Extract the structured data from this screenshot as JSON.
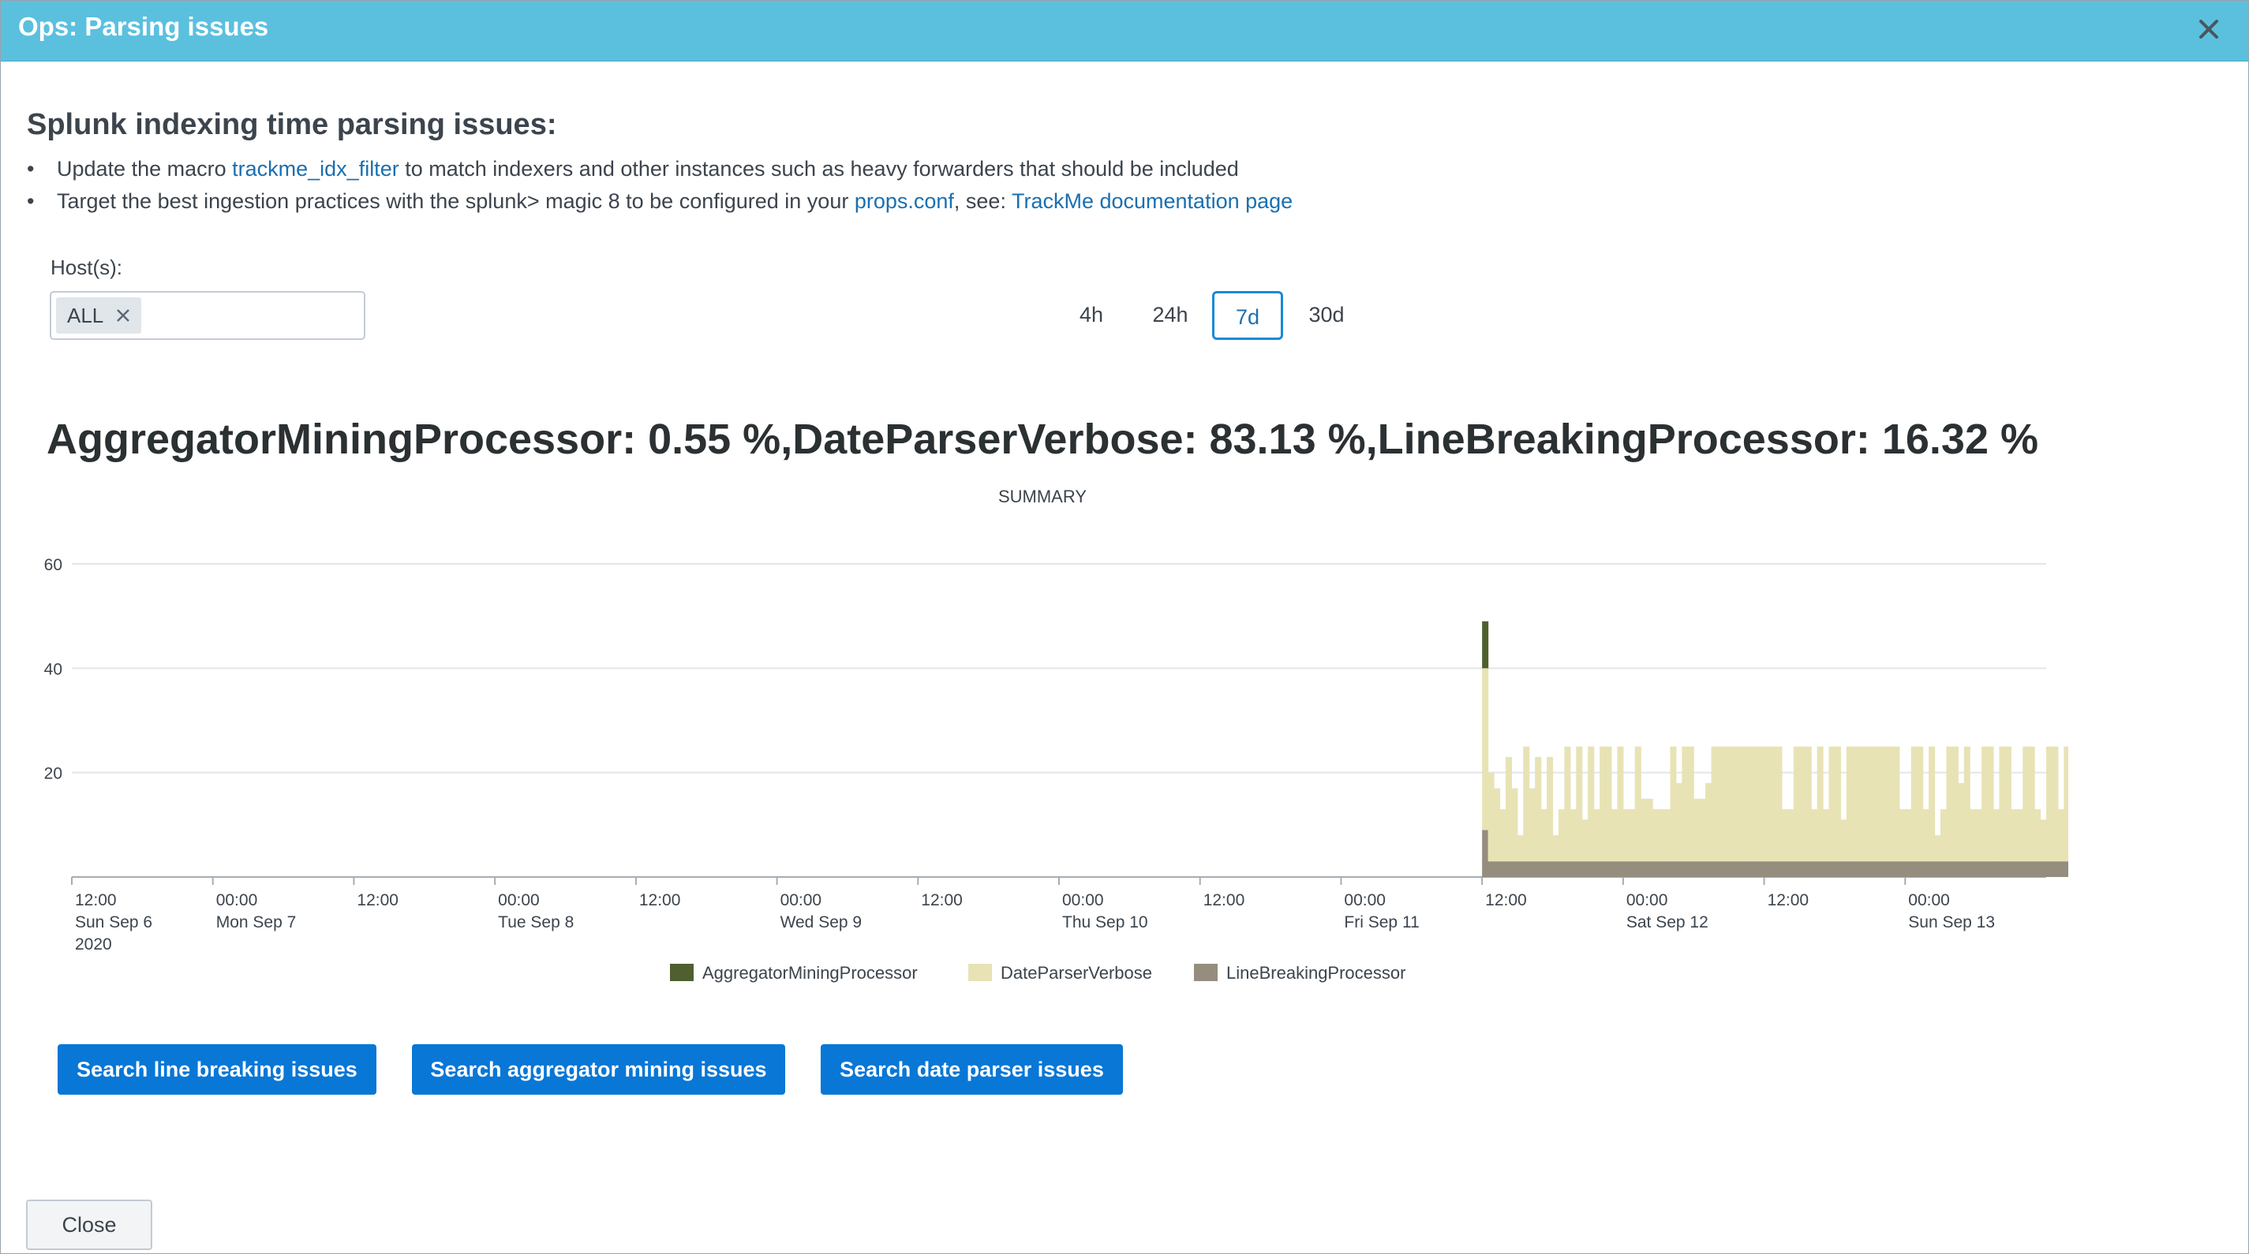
{
  "modal": {
    "title": "Ops: Parsing issues",
    "heading": "Splunk indexing time parsing issues:",
    "bullet1": {
      "prefix": "Update the macro ",
      "link": "trackme_idx_filter",
      "suffix": " to match indexers and other instances such as heavy forwarders that should be included"
    },
    "bullet2": {
      "prefix": "Target the best ingestion practices with the splunk> magic 8 to be configured in your ",
      "link1": "props.conf",
      "middle": ", see: ",
      "link2": "TrackMe documentation page"
    },
    "close_label": "Close"
  },
  "filters": {
    "host_label": "Host(s):",
    "host_values": [
      "ALL"
    ],
    "time_ranges": [
      "4h",
      "24h",
      "7d",
      "30d"
    ],
    "selected_range": "7d"
  },
  "headline": "AggregatorMiningProcessor: 0.55 %,DateParserVerbose: 83.13 %,LineBreakingProcessor: 16.32 %",
  "buttons": {
    "line_breaking": "Search line breaking issues",
    "aggregator": "Search aggregator mining issues",
    "date_parser": "Search date parser issues"
  },
  "colors": {
    "header": "#5bc0de",
    "button": "#0877d6",
    "link": "#1a6fb0",
    "AggregatorMiningProcessor": "#4f5f2f",
    "DateParserVerbose": "#e7e3b5",
    "LineBreakingProcessor": "#958e7e"
  },
  "chart_data": {
    "type": "area",
    "title": "SUMMARY",
    "stacked": true,
    "ylim": [
      0,
      60
    ],
    "y_ticks": [
      20,
      40,
      60
    ],
    "x_ticks": [
      {
        "label": [
          "12:00",
          "Sun Sep 6",
          "2020"
        ]
      },
      {
        "label": [
          "00:00",
          "Mon Sep 7"
        ]
      },
      {
        "label": [
          "12:00"
        ]
      },
      {
        "label": [
          "00:00",
          "Tue Sep 8"
        ]
      },
      {
        "label": [
          "12:00"
        ]
      },
      {
        "label": [
          "00:00",
          "Wed Sep 9"
        ]
      },
      {
        "label": [
          "12:00"
        ]
      },
      {
        "label": [
          "00:00",
          "Thu Sep 10"
        ]
      },
      {
        "label": [
          "12:00"
        ]
      },
      {
        "label": [
          "00:00",
          "Fri Sep 11"
        ]
      },
      {
        "label": [
          "12:00"
        ]
      },
      {
        "label": [
          "00:00",
          "Sat Sep 12"
        ]
      },
      {
        "label": [
          "12:00"
        ]
      },
      {
        "label": [
          "00:00",
          "Sun Sep 13"
        ]
      }
    ],
    "x_range_hours": [
      132,
      300
    ],
    "data_start_hour": 252,
    "bin_hours": 0.5,
    "legend": [
      "AggregatorMiningProcessor",
      "DateParserVerbose",
      "LineBreakingProcessor"
    ],
    "legend_position": "bottom",
    "grid": true,
    "series": [
      {
        "name": "AggregatorMiningProcessor",
        "values": [
          9,
          0
        ]
      },
      {
        "name": "DateParserVerbose",
        "values": [
          31,
          17,
          14,
          10,
          20,
          14,
          5,
          22,
          14,
          20,
          10,
          20,
          5,
          10,
          22,
          10,
          22,
          8,
          22,
          10,
          22,
          22,
          10,
          22,
          10,
          10,
          22,
          12,
          12,
          10,
          10,
          10,
          22,
          15,
          22,
          22,
          12,
          12,
          15,
          22,
          22,
          22,
          22,
          22,
          22,
          22,
          22,
          22,
          22,
          22,
          22,
          10,
          10,
          22,
          22,
          22,
          10,
          22,
          10,
          22,
          22,
          8,
          22,
          22,
          22,
          22,
          22,
          22,
          22,
          22,
          22,
          10,
          10,
          22,
          22,
          10,
          22,
          5,
          10,
          22,
          22,
          15,
          22,
          10,
          10,
          22,
          22,
          10,
          22,
          22,
          10,
          10,
          22,
          22,
          10,
          8,
          22,
          22,
          10,
          22,
          22,
          10,
          22,
          22,
          22,
          10,
          22,
          22,
          22,
          10,
          22,
          22,
          15,
          10,
          22,
          22,
          22,
          22,
          22,
          10,
          22,
          22,
          10,
          22,
          22,
          10,
          22,
          22,
          22,
          10
        ]
      },
      {
        "name": "LineBreakingProcessor",
        "values": [
          9,
          3,
          3,
          3,
          3,
          3,
          3,
          3,
          3,
          3,
          3,
          3,
          3,
          3,
          3,
          3,
          3,
          3,
          3,
          3,
          3,
          3,
          3,
          3,
          3,
          3,
          3,
          3,
          3,
          3,
          3,
          3,
          3,
          3,
          3,
          3,
          3,
          3,
          3,
          3,
          3,
          3,
          3,
          3,
          3,
          3,
          3,
          3,
          3,
          3,
          3,
          3,
          3,
          3,
          3,
          3,
          3,
          3,
          3,
          3,
          3,
          3,
          3,
          3,
          3,
          3,
          3,
          3,
          3,
          3,
          3,
          3,
          3,
          3,
          3,
          3,
          3,
          3,
          3,
          3,
          3,
          3,
          3,
          3,
          3,
          3,
          3,
          3,
          3,
          3,
          3,
          3,
          3,
          3,
          3,
          3,
          3,
          3,
          3,
          3,
          3,
          3,
          3,
          3,
          3,
          3,
          3,
          3,
          3,
          3,
          3,
          3,
          3,
          3,
          3,
          3,
          3,
          3,
          3,
          3,
          3,
          3,
          3,
          3,
          3,
          3,
          3,
          3,
          3,
          3
        ]
      }
    ]
  }
}
